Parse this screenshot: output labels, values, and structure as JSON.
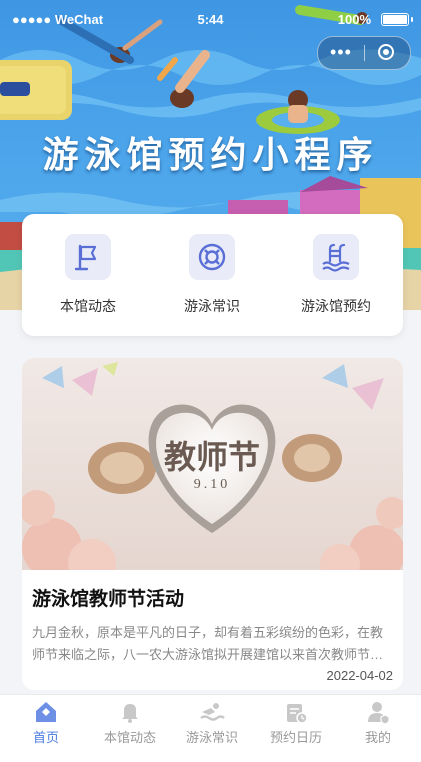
{
  "status_bar": {
    "carrier": "●●●●● WeChat",
    "time": "5:44",
    "battery": "100%"
  },
  "hero": {
    "title": "游泳馆预约小程序"
  },
  "quick_nav": [
    {
      "label": "本馆动态",
      "icon": "flag-icon"
    },
    {
      "label": "游泳常识",
      "icon": "lifebuoy-icon"
    },
    {
      "label": "游泳馆预约",
      "icon": "pool-ladder-icon"
    }
  ],
  "article": {
    "image_text": "教师节",
    "image_subtext": "9.10",
    "title": "游泳馆教师节活动",
    "excerpt": "九月金秋，原本是平凡的日子，却有着五彩缤纷的色彩，在教师节来临之际，八一农大游泳馆拟开展建馆以来首次教师节…",
    "date": "2022-04-02"
  },
  "tabs": [
    {
      "label": "首页",
      "icon": "home-icon",
      "active": true
    },
    {
      "label": "本馆动态",
      "icon": "bell-icon",
      "active": false
    },
    {
      "label": "游泳常识",
      "icon": "swimmer-icon",
      "active": false
    },
    {
      "label": "预约日历",
      "icon": "calendar-icon",
      "active": false
    },
    {
      "label": "我的",
      "icon": "user-icon",
      "active": false
    }
  ],
  "colors": {
    "accent": "#4a7be0",
    "icon_tint": "#5a6fd6",
    "icon_bg": "#e9ecf8"
  }
}
